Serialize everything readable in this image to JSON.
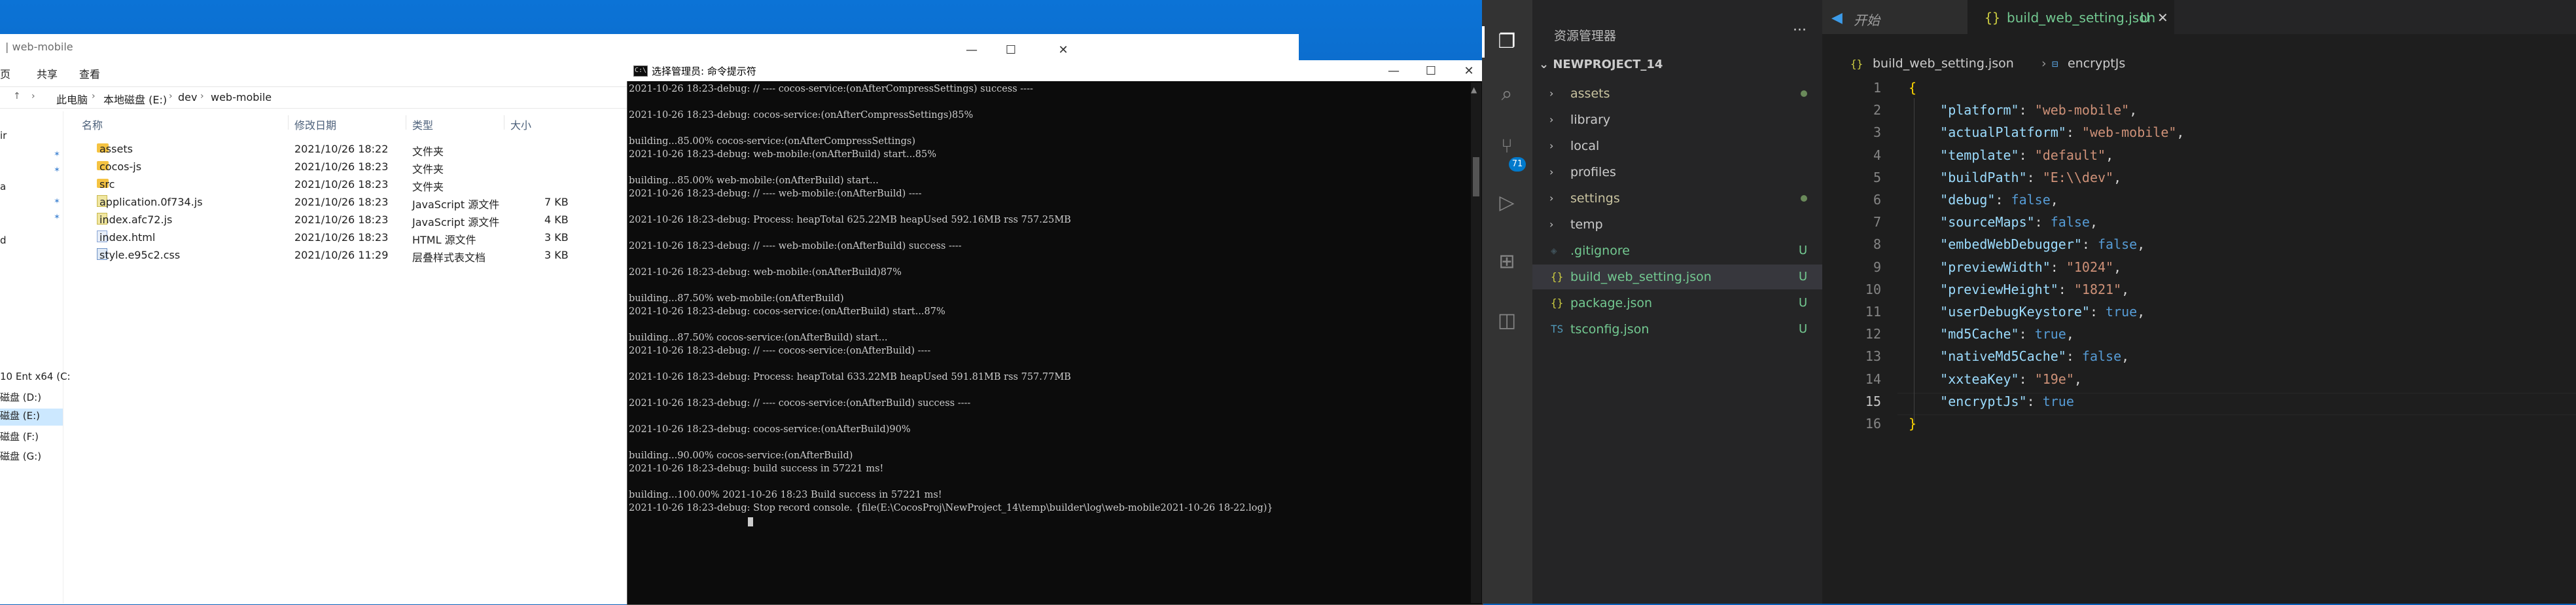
{
  "explorer": {
    "title": "| web-mobile",
    "ribbon_tabs": [
      "页",
      "共享",
      "查看"
    ],
    "address": [
      "此电脑",
      "本地磁盘 (E:)",
      "dev",
      "web-mobile"
    ],
    "columns": [
      "名称",
      "修改日期",
      "类型",
      "大小"
    ],
    "files": [
      {
        "name": "assets",
        "date": "2021/10/26 18:22",
        "type": "文件夹",
        "size": "",
        "kind": "folder"
      },
      {
        "name": "cocos-js",
        "date": "2021/10/26 18:23",
        "type": "文件夹",
        "size": "",
        "kind": "folder"
      },
      {
        "name": "src",
        "date": "2021/10/26 18:23",
        "type": "文件夹",
        "size": "",
        "kind": "folder"
      },
      {
        "name": "application.0f734.js",
        "date": "2021/10/26 18:23",
        "type": "JavaScript 源文件",
        "size": "7 KB",
        "kind": "js"
      },
      {
        "name": "index.afc72.js",
        "date": "2021/10/26 18:23",
        "type": "JavaScript 源文件",
        "size": "4 KB",
        "kind": "js"
      },
      {
        "name": "index.html",
        "date": "2021/10/26 18:23",
        "type": "HTML 源文件",
        "size": "3 KB",
        "kind": "html"
      },
      {
        "name": "style.e95c2.css",
        "date": "2021/10/26 11:29",
        "type": "层叠样式表文档",
        "size": "3 KB",
        "kind": "css"
      }
    ],
    "nav": [
      "10 Ent x64 (C:",
      "磁盘 (D:)",
      "磁盘 (E:)",
      "磁盘 (F:)",
      "磁盘 (G:)"
    ],
    "nav_partial": [
      "ir",
      "a",
      "d"
    ]
  },
  "cmd": {
    "title": "选择管理员: 命令提示符",
    "icon_glyph": "C:\\",
    "lines": [
      "2021-10-26 18:23-debug: // ---- cocos-service:(onAfterCompressSettings) success ----",
      "",
      "2021-10-26 18:23-debug: cocos-service:(onAfterCompressSettings)85%",
      "",
      "building...85.00% cocos-service:(onAfterCompressSettings)",
      "2021-10-26 18:23-debug: web-mobile:(onAfterBuild) start...85%",
      "",
      "building...85.00% web-mobile:(onAfterBuild) start...",
      "2021-10-26 18:23-debug: // ---- web-mobile:(onAfterBuild) ----",
      "",
      "2021-10-26 18:23-debug: Process: heapTotal 625.22MB heapUsed 592.16MB rss 757.25MB",
      "",
      "2021-10-26 18:23-debug: // ---- web-mobile:(onAfterBuild) success ----",
      "",
      "2021-10-26 18:23-debug: web-mobile:(onAfterBuild)87%",
      "",
      "building...87.50% web-mobile:(onAfterBuild)",
      "2021-10-26 18:23-debug: cocos-service:(onAfterBuild) start...87%",
      "",
      "building...87.50% cocos-service:(onAfterBuild) start...",
      "2021-10-26 18:23-debug: // ---- cocos-service:(onAfterBuild) ----",
      "",
      "2021-10-26 18:23-debug: Process: heapTotal 633.22MB heapUsed 591.81MB rss 757.77MB",
      "",
      "2021-10-26 18:23-debug: // ---- cocos-service:(onAfterBuild) success ----",
      "",
      "2021-10-26 18:23-debug: cocos-service:(onAfterBuild)90%",
      "",
      "building...90.00% cocos-service:(onAfterBuild)",
      "2021-10-26 18:23-debug: build success in 57221 ms!",
      "",
      "building...100.00% 2021-10-26 18:23 Build success in 57221 ms!",
      "2021-10-26 18:23-debug: Stop record console. {file(E:\\CocosProj\\NewProject_14\\temp\\builder\\log\\web-mobile2021-10-26 18-22.log)}"
    ]
  },
  "window_buttons": {
    "minimize": "—",
    "maximize": "☐",
    "close": "✕"
  },
  "vscode": {
    "sidebar_title": "资源管理器",
    "more": "···",
    "project": "NEWPROJECT_14",
    "badge_count": "71",
    "tree": [
      {
        "name": "assets",
        "type": "folder",
        "status": "dot",
        "color": "#c9c3a0"
      },
      {
        "name": "library",
        "type": "folder",
        "status": "",
        "color": "#cccccc"
      },
      {
        "name": "local",
        "type": "folder",
        "status": "",
        "color": "#cccccc"
      },
      {
        "name": "profiles",
        "type": "folder",
        "status": "",
        "color": "#cccccc"
      },
      {
        "name": "settings",
        "type": "folder",
        "status": "dot",
        "color": "#c9c3a0"
      },
      {
        "name": "temp",
        "type": "folder",
        "status": "",
        "color": "#cccccc"
      },
      {
        "name": ".gitignore",
        "type": "file",
        "status": "U",
        "color": "#73c991",
        "icon": "◈",
        "icon_color": "#41535b"
      },
      {
        "name": "build_web_setting.json",
        "type": "file",
        "status": "U",
        "color": "#73c991",
        "icon": "{}",
        "icon_color": "#cbcb41",
        "selected": true
      },
      {
        "name": "package.json",
        "type": "file",
        "status": "U",
        "color": "#73c991",
        "icon": "{}",
        "icon_color": "#cbcb41"
      },
      {
        "name": "tsconfig.json",
        "type": "file",
        "status": "U",
        "color": "#73c991",
        "icon": "TS",
        "icon_color": "#519aba"
      }
    ],
    "tabs": [
      {
        "label": "开始",
        "icon": "vscode-logo-icon"
      },
      {
        "label": "build_web_setting.json",
        "modified": "U",
        "close": "✕"
      }
    ],
    "breadcrumb": [
      "build_web_setting.json",
      "encryptJs"
    ],
    "line_numbers": [
      "1",
      "2",
      "3",
      "4",
      "5",
      "6",
      "7",
      "8",
      "9",
      "10",
      "11",
      "12",
      "13",
      "14",
      "15",
      "16"
    ],
    "current_line": "15",
    "code": [
      [
        {
          "t": "{",
          "c": "brace"
        }
      ],
      [
        {
          "t": "    ",
          "c": "p"
        },
        {
          "t": "\"platform\"",
          "c": "k"
        },
        {
          "t": ": ",
          "c": "p"
        },
        {
          "t": "\"web-mobile\"",
          "c": "s"
        },
        {
          "t": ",",
          "c": "p"
        }
      ],
      [
        {
          "t": "    ",
          "c": "p"
        },
        {
          "t": "\"actualPlatform\"",
          "c": "k"
        },
        {
          "t": ": ",
          "c": "p"
        },
        {
          "t": "\"web-mobile\"",
          "c": "s"
        },
        {
          "t": ",",
          "c": "p"
        }
      ],
      [
        {
          "t": "    ",
          "c": "p"
        },
        {
          "t": "\"template\"",
          "c": "k"
        },
        {
          "t": ": ",
          "c": "p"
        },
        {
          "t": "\"default\"",
          "c": "s"
        },
        {
          "t": ",",
          "c": "p"
        }
      ],
      [
        {
          "t": "    ",
          "c": "p"
        },
        {
          "t": "\"buildPath\"",
          "c": "k"
        },
        {
          "t": ": ",
          "c": "p"
        },
        {
          "t": "\"E:\\\\dev\"",
          "c": "s"
        },
        {
          "t": ",",
          "c": "p"
        }
      ],
      [
        {
          "t": "    ",
          "c": "p"
        },
        {
          "t": "\"debug\"",
          "c": "k"
        },
        {
          "t": ": ",
          "c": "p"
        },
        {
          "t": "false",
          "c": "b"
        },
        {
          "t": ",",
          "c": "p"
        }
      ],
      [
        {
          "t": "    ",
          "c": "p"
        },
        {
          "t": "\"sourceMaps\"",
          "c": "k"
        },
        {
          "t": ": ",
          "c": "p"
        },
        {
          "t": "false",
          "c": "b"
        },
        {
          "t": ",",
          "c": "p"
        }
      ],
      [
        {
          "t": "    ",
          "c": "p"
        },
        {
          "t": "\"embedWebDebugger\"",
          "c": "k"
        },
        {
          "t": ": ",
          "c": "p"
        },
        {
          "t": "false",
          "c": "b"
        },
        {
          "t": ",",
          "c": "p"
        }
      ],
      [
        {
          "t": "    ",
          "c": "p"
        },
        {
          "t": "\"previewWidth\"",
          "c": "k"
        },
        {
          "t": ": ",
          "c": "p"
        },
        {
          "t": "\"1024\"",
          "c": "s"
        },
        {
          "t": ",",
          "c": "p"
        }
      ],
      [
        {
          "t": "    ",
          "c": "p"
        },
        {
          "t": "\"previewHeight\"",
          "c": "k"
        },
        {
          "t": ": ",
          "c": "p"
        },
        {
          "t": "\"1821\"",
          "c": "s"
        },
        {
          "t": ",",
          "c": "p"
        }
      ],
      [
        {
          "t": "    ",
          "c": "p"
        },
        {
          "t": "\"userDebugKeystore\"",
          "c": "k"
        },
        {
          "t": ": ",
          "c": "p"
        },
        {
          "t": "true",
          "c": "b"
        },
        {
          "t": ",",
          "c": "p"
        }
      ],
      [
        {
          "t": "    ",
          "c": "p"
        },
        {
          "t": "\"md5Cache\"",
          "c": "k"
        },
        {
          "t": ": ",
          "c": "p"
        },
        {
          "t": "true",
          "c": "b"
        },
        {
          "t": ",",
          "c": "p"
        }
      ],
      [
        {
          "t": "    ",
          "c": "p"
        },
        {
          "t": "\"nativeMd5Cache\"",
          "c": "k"
        },
        {
          "t": ": ",
          "c": "p"
        },
        {
          "t": "false",
          "c": "b"
        },
        {
          "t": ",",
          "c": "p"
        }
      ],
      [
        {
          "t": "    ",
          "c": "p"
        },
        {
          "t": "\"xxteaKey\"",
          "c": "k"
        },
        {
          "t": ": ",
          "c": "p"
        },
        {
          "t": "\"19e\"",
          "c": "s"
        },
        {
          "t": ",",
          "c": "p"
        }
      ],
      [
        {
          "t": "    ",
          "c": "p"
        },
        {
          "t": "\"encryptJs\"",
          "c": "k"
        },
        {
          "t": ": ",
          "c": "p"
        },
        {
          "t": "true",
          "c": "b"
        }
      ],
      [
        {
          "t": "}",
          "c": "brace"
        }
      ]
    ]
  },
  "colors": {
    "vscode_bg": "#1e1e1e",
    "sidebar_bg": "#252526",
    "activity_bg": "#333333",
    "accent": "#007acc",
    "untracked": "#73c991"
  }
}
